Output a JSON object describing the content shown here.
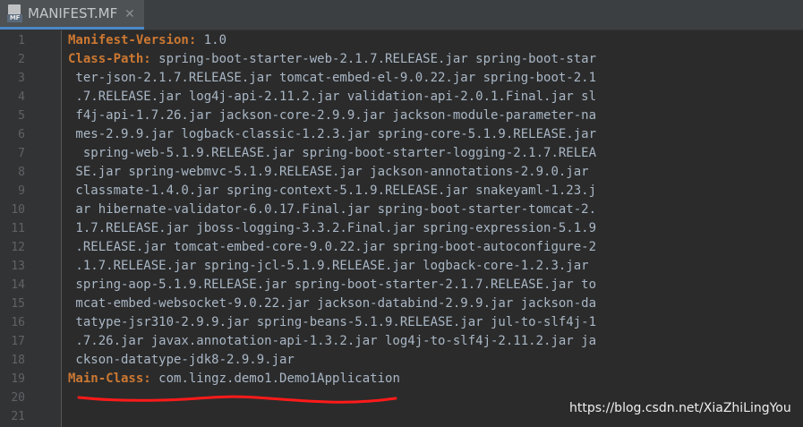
{
  "tab": {
    "title": "MANIFEST.MF",
    "icon_badge": "MF",
    "close": "✕"
  },
  "editor": {
    "key_color": "#cc7832",
    "text_color": "#a9b7c6",
    "lines": [
      {
        "n": "1",
        "key": "Manifest-Version",
        "sep": ":",
        "val": " 1.0"
      },
      {
        "n": "2",
        "key": "Class-Path",
        "sep": ":",
        "val": " spring-boot-starter-web-2.1.7.RELEASE.jar spring-boot-star"
      },
      {
        "n": "3",
        "key": "",
        "sep": "",
        "val": " ter-json-2.1.7.RELEASE.jar tomcat-embed-el-9.0.22.jar spring-boot-2.1"
      },
      {
        "n": "4",
        "key": "",
        "sep": "",
        "val": " .7.RELEASE.jar log4j-api-2.11.2.jar validation-api-2.0.1.Final.jar sl"
      },
      {
        "n": "5",
        "key": "",
        "sep": "",
        "val": " f4j-api-1.7.26.jar jackson-core-2.9.9.jar jackson-module-parameter-na"
      },
      {
        "n": "6",
        "key": "",
        "sep": "",
        "val": " mes-2.9.9.jar logback-classic-1.2.3.jar spring-core-5.1.9.RELEASE.jar"
      },
      {
        "n": "7",
        "key": "",
        "sep": "",
        "val": "  spring-web-5.1.9.RELEASE.jar spring-boot-starter-logging-2.1.7.RELEA"
      },
      {
        "n": "8",
        "key": "",
        "sep": "",
        "val": " SE.jar spring-webmvc-5.1.9.RELEASE.jar jackson-annotations-2.9.0.jar"
      },
      {
        "n": "9",
        "key": "",
        "sep": "",
        "val": " classmate-1.4.0.jar spring-context-5.1.9.RELEASE.jar snakeyaml-1.23.j"
      },
      {
        "n": "10",
        "key": "",
        "sep": "",
        "val": " ar hibernate-validator-6.0.17.Final.jar spring-boot-starter-tomcat-2."
      },
      {
        "n": "11",
        "key": "",
        "sep": "",
        "val": " 1.7.RELEASE.jar jboss-logging-3.3.2.Final.jar spring-expression-5.1.9"
      },
      {
        "n": "12",
        "key": "",
        "sep": "",
        "val": " .RELEASE.jar tomcat-embed-core-9.0.22.jar spring-boot-autoconfigure-2"
      },
      {
        "n": "13",
        "key": "",
        "sep": "",
        "val": " .1.7.RELEASE.jar spring-jcl-5.1.9.RELEASE.jar logback-core-1.2.3.jar"
      },
      {
        "n": "14",
        "key": "",
        "sep": "",
        "val": " spring-aop-5.1.9.RELEASE.jar spring-boot-starter-2.1.7.RELEASE.jar to"
      },
      {
        "n": "15",
        "key": "",
        "sep": "",
        "val": " mcat-embed-websocket-9.0.22.jar jackson-databind-2.9.9.jar jackson-da"
      },
      {
        "n": "16",
        "key": "",
        "sep": "",
        "val": " tatype-jsr310-2.9.9.jar spring-beans-5.1.9.RELEASE.jar jul-to-slf4j-1"
      },
      {
        "n": "17",
        "key": "",
        "sep": "",
        "val": " .7.26.jar javax.annotation-api-1.3.2.jar log4j-to-slf4j-2.11.2.jar ja"
      },
      {
        "n": "18",
        "key": "",
        "sep": "",
        "val": " ckson-datatype-jdk8-2.9.9.jar"
      },
      {
        "n": "19",
        "key": "Main-Class",
        "sep": ":",
        "val": " com.lingz.demo1.Demo1Application"
      },
      {
        "n": "20",
        "key": "",
        "sep": "",
        "val": ""
      },
      {
        "n": "21",
        "key": "",
        "sep": "",
        "val": ""
      }
    ]
  },
  "annotation": {
    "underline_color": "#ff1a1a"
  },
  "watermark": {
    "text": "https://blog.csdn.net/XiaZhiLingYou"
  }
}
